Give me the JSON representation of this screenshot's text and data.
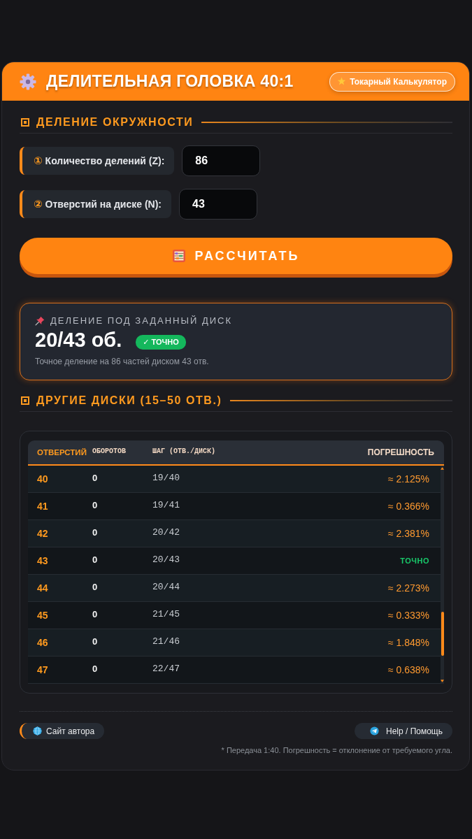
{
  "header": {
    "title": "ДЕЛИТЕЛЬНАЯ ГОЛОВКА 40:1",
    "link_button": "Токарный Калькулятор"
  },
  "section_1": {
    "title": "ДЕЛЕНИЕ ОКРУЖНОСТИ"
  },
  "fields": [
    {
      "number": "①",
      "label": "Количество делений (Z):",
      "value": "86"
    },
    {
      "number": "②",
      "label": "Отверстий на диске (N):",
      "value": "43"
    }
  ],
  "calculate_button": "РАССЧИТАТЬ",
  "result": {
    "title": "ДЕЛЕНИЕ ПОД ЗАДАННЫЙ ДИСК",
    "value": "20/43 об.",
    "badge": "✓ ТОЧНО",
    "description": "Точное деление на 86 частей диском 43 отв."
  },
  "section_2": {
    "title": "ДРУГИЕ ДИСКИ (15–50 ОТВ.)"
  },
  "table": {
    "columns": [
      "ОТВЕРСТИЙ",
      "ОБОРОТОВ",
      "ШАГ (ОТВ./ДИСК)",
      "ПОГРЕШНОСТЬ"
    ],
    "rows": [
      {
        "holes": "40",
        "turns": "0",
        "step": "19/40",
        "error": "≈ 2.125%",
        "exact": false
      },
      {
        "holes": "41",
        "turns": "0",
        "step": "19/41",
        "error": "≈ 0.366%",
        "exact": false
      },
      {
        "holes": "42",
        "turns": "0",
        "step": "20/42",
        "error": "≈ 2.381%",
        "exact": false
      },
      {
        "holes": "43",
        "turns": "0",
        "step": "20/43",
        "error": "ТОЧНО",
        "exact": true
      },
      {
        "holes": "44",
        "turns": "0",
        "step": "20/44",
        "error": "≈ 2.273%",
        "exact": false
      },
      {
        "holes": "45",
        "turns": "0",
        "step": "21/45",
        "error": "≈ 0.333%",
        "exact": false
      },
      {
        "holes": "46",
        "turns": "0",
        "step": "21/46",
        "error": "≈ 1.848%",
        "exact": false
      },
      {
        "holes": "47",
        "turns": "0",
        "step": "22/47",
        "error": "≈ 0.638%",
        "exact": false
      }
    ]
  },
  "footer": {
    "author_link": "Сайт автора",
    "help_link": "Help / Помощь",
    "note": "* Передача 1:40. Погрешность = отклонение от требуемого угла."
  }
}
